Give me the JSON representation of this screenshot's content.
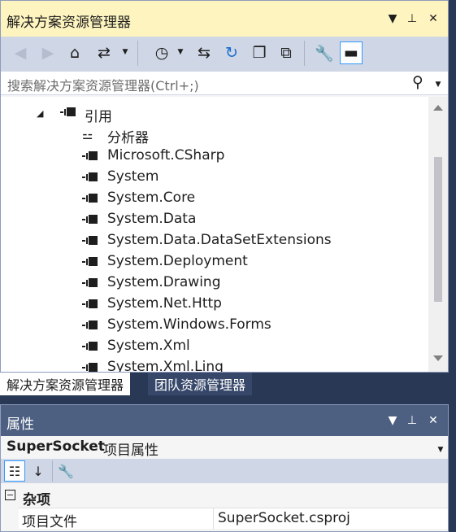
{
  "solution_explorer": {
    "title": "解决方案资源管理器",
    "title_buttons": {
      "dropdown": "▼",
      "pin": "⊥",
      "close": "✕"
    },
    "search": {
      "placeholder": "搜索解决方案资源管理器(Ctrl+;)"
    },
    "toolbar_icons": [
      "back-icon",
      "forward-icon",
      "home-icon",
      "sync-view-icon",
      "pending-changes-icon",
      "switch-views-icon",
      "refresh-icon",
      "collapse-all-icon",
      "show-all-files-icon",
      "properties-icon",
      "preview-icon"
    ],
    "tree": {
      "references_node": "引用",
      "analyzer": "分析器",
      "items": [
        "Microsoft.CSharp",
        "System",
        "System.Core",
        "System.Data",
        "System.Data.DataSetExtensions",
        "System.Deployment",
        "System.Drawing",
        "System.Net.Http",
        "System.Windows.Forms",
        "System.Xml",
        "System.Xml.Linq"
      ]
    }
  },
  "tabs": {
    "solution_explorer": "解决方案资源管理器",
    "team_explorer": "团队资源管理器"
  },
  "properties": {
    "title": "属性",
    "object_name": "SuperSocket",
    "object_type": "项目属性",
    "category": "杂项",
    "category_toggle": "−",
    "rows": [
      {
        "name": "项目文件",
        "value": "SuperSocket.csproj"
      }
    ]
  },
  "colors": {
    "active_title": "#fdf4bf",
    "inactive_title": "#4d6082",
    "toolbar": "#cfd6e5",
    "frame": "#293955"
  }
}
